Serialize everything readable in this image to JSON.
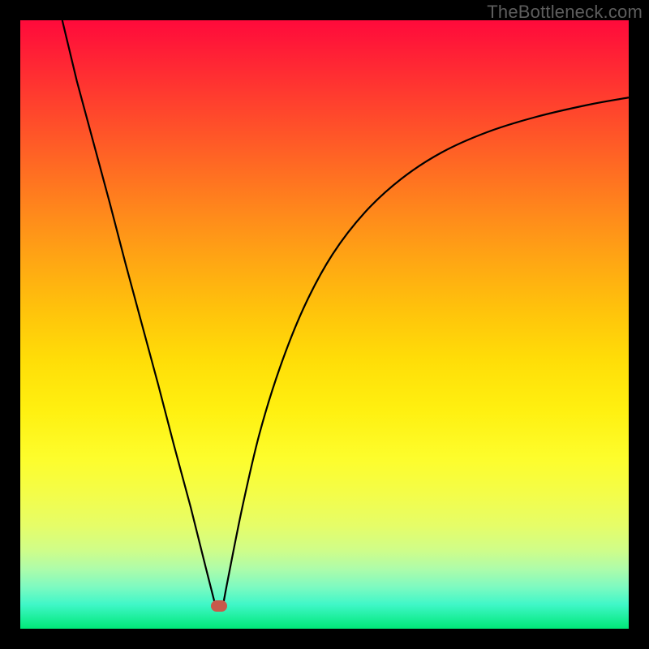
{
  "watermark": "TheBottleneck.com",
  "colors": {
    "marker": "#c85a4a",
    "curve": "#000000"
  },
  "chart_data": {
    "type": "line",
    "title": "",
    "xlabel": "",
    "ylabel": "",
    "xlim": [
      0,
      100
    ],
    "ylim": [
      0,
      100
    ],
    "grid": false,
    "legend": false,
    "series": [
      {
        "name": "left-branch",
        "x": [
          6.9,
          9.3,
          12.0,
          14.7,
          17.3,
          20.0,
          22.7,
          25.3,
          28.0,
          30.5,
          32.1
        ],
        "y": [
          100.0,
          90.0,
          80.0,
          70.0,
          60.0,
          50.0,
          40.0,
          30.0,
          20.0,
          10.0,
          3.7
        ]
      },
      {
        "name": "right-branch",
        "x": [
          33.3,
          34.1,
          36.5,
          39.3,
          42.7,
          46.7,
          51.3,
          56.7,
          62.7,
          69.3,
          76.7,
          84.7,
          93.3,
          100.0
        ],
        "y": [
          3.7,
          8.0,
          20.0,
          32.0,
          43.0,
          53.0,
          61.5,
          68.5,
          74.0,
          78.3,
          81.6,
          84.1,
          86.1,
          87.3
        ]
      }
    ],
    "marker": {
      "x": 32.7,
      "y": 3.7
    }
  }
}
